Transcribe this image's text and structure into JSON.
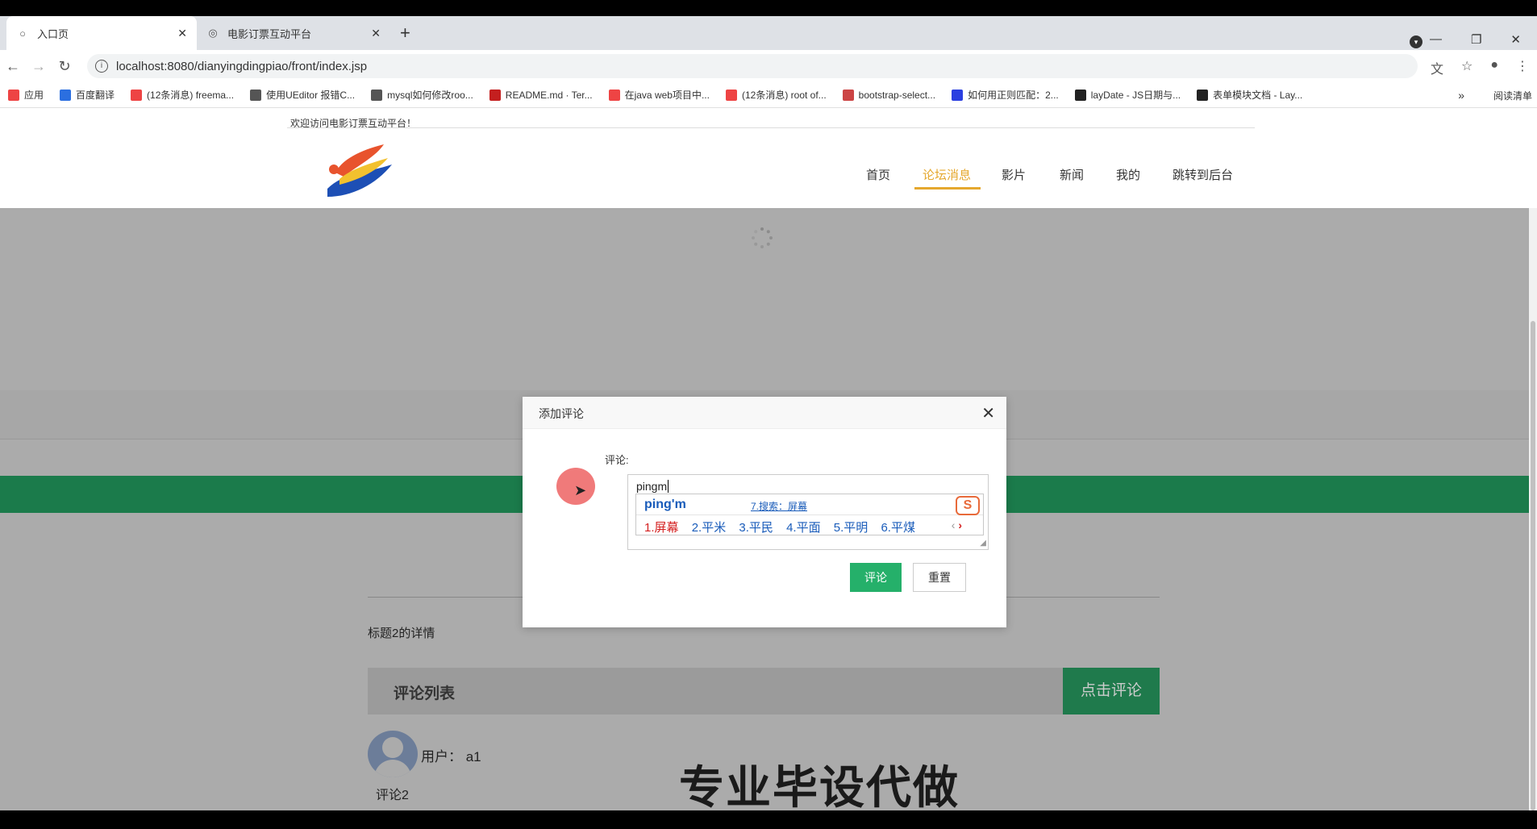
{
  "browser": {
    "tabs": [
      {
        "label": "入口页",
        "active": true
      },
      {
        "label": "电影订票互动平台",
        "active": false
      }
    ],
    "url": "localhost:8080/dianyingdingpiao/front/index.jsp",
    "bookmarks": [
      {
        "label": "应用",
        "color": "#e44"
      },
      {
        "label": "百度翻译",
        "color": "#2b6fe0"
      },
      {
        "label": "(12条消息) freema...",
        "color": "#e44"
      },
      {
        "label": "使用UEditor 报错C...",
        "color": "#555"
      },
      {
        "label": "mysql如何修改roo...",
        "color": "#555"
      },
      {
        "label": "README.md · Ter...",
        "color": "#c41f1f"
      },
      {
        "label": "在java web项目中...",
        "color": "#e44"
      },
      {
        "label": "(12条消息) root of...",
        "color": "#e44"
      },
      {
        "label": "bootstrap-select...",
        "color": "#c44"
      },
      {
        "label": "如何用正则匹配：2...",
        "color": "#2b3fe0"
      },
      {
        "label": "layDate - JS日期与...",
        "color": "#222"
      },
      {
        "label": "表单模块文档 - Lay...",
        "color": "#222"
      }
    ],
    "bookmarks_more": "»",
    "reading_list": "阅读清单"
  },
  "site": {
    "welcome": "欢迎访问电影订票互动平台！",
    "nav": [
      "首页",
      "论坛消息",
      "影片",
      "新闻",
      "我的",
      "跳转到后台"
    ],
    "active_nav": "论坛消息",
    "accent_color": "#e5a82e"
  },
  "content": {
    "detail_title": "标题2的详情",
    "comment_list_title": "评论列表",
    "comment_button": "点击评论",
    "user_label": "用户： a1",
    "comment_text": "评论2",
    "watermark": "专业毕设代做"
  },
  "modal": {
    "title": "添加评论",
    "field_label": "评论:",
    "textarea_value": "pingm",
    "submit_label": "评论",
    "reset_label": "重置"
  },
  "ime": {
    "pinyin": "ping'm",
    "search": "7.搜索：屏幕",
    "candidates": [
      "1.屏幕",
      "2.平米",
      "3.平民",
      "4.平面",
      "5.平明",
      "6.平煤"
    ],
    "logo": "S"
  }
}
